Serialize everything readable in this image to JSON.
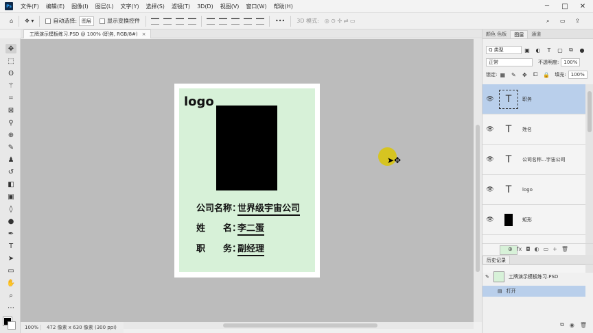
{
  "app": {
    "logo": "Ps",
    "menu": [
      "文件(F)",
      "编辑(E)",
      "图像(I)",
      "图层(L)",
      "文字(Y)",
      "选择(S)",
      "滤镜(T)",
      "3D(D)",
      "视图(V)",
      "窗口(W)",
      "帮助(H)"
    ],
    "window_controls": [
      "─",
      "□",
      "✕"
    ]
  },
  "options": {
    "auto_select_label": "自动选择:",
    "auto_select_value": "图层",
    "show_transform_label": "显示变换控件",
    "mode_3d_label": "3D 模式:",
    "more": "•••"
  },
  "document": {
    "tab_title": "工牌演示模板练习.PSD @ 100% (职务, RGB/8#)",
    "tab_close": "×"
  },
  "card": {
    "logo": "logo",
    "company_label": "公司名称：",
    "company_value": "世界级宇宙公司",
    "name_label": "姓　　名：",
    "name_value": "李二蛋",
    "title_label": "职　　务：",
    "title_value": "副经理"
  },
  "status": {
    "zoom": "100%",
    "info": "472 像素 x 630 像素 (300 ppi)"
  },
  "panels": {
    "top_tabs": [
      "颜色 色板",
      "图层",
      "通道"
    ],
    "filter_label": "Q 类型",
    "blend_mode": "正常",
    "opacity_label": "不透明度:",
    "opacity_value": "100%",
    "lock_label": "锁定:",
    "fill_label": "填充:",
    "fill_value": "100%",
    "layers": [
      {
        "name": "职务",
        "type": "T",
        "selected": true
      },
      {
        "name": "姓名",
        "type": "T",
        "selected": false
      },
      {
        "name": "公司名称...宇宙公司",
        "type": "T",
        "selected": false
      },
      {
        "name": "logo",
        "type": "T",
        "selected": false
      },
      {
        "name": "矩形",
        "type": "rect",
        "selected": false
      }
    ],
    "layers_footer": [
      "⊕",
      "fx",
      "◘",
      "◐",
      "▭",
      "+",
      "🗑"
    ],
    "history_tab": "历史记录",
    "history": [
      {
        "label": "工牌演示模板练习.PSD",
        "selected": false
      },
      {
        "label": "打开",
        "selected": true
      }
    ],
    "history_footer": [
      "⧉",
      "◉",
      "🗑"
    ]
  }
}
